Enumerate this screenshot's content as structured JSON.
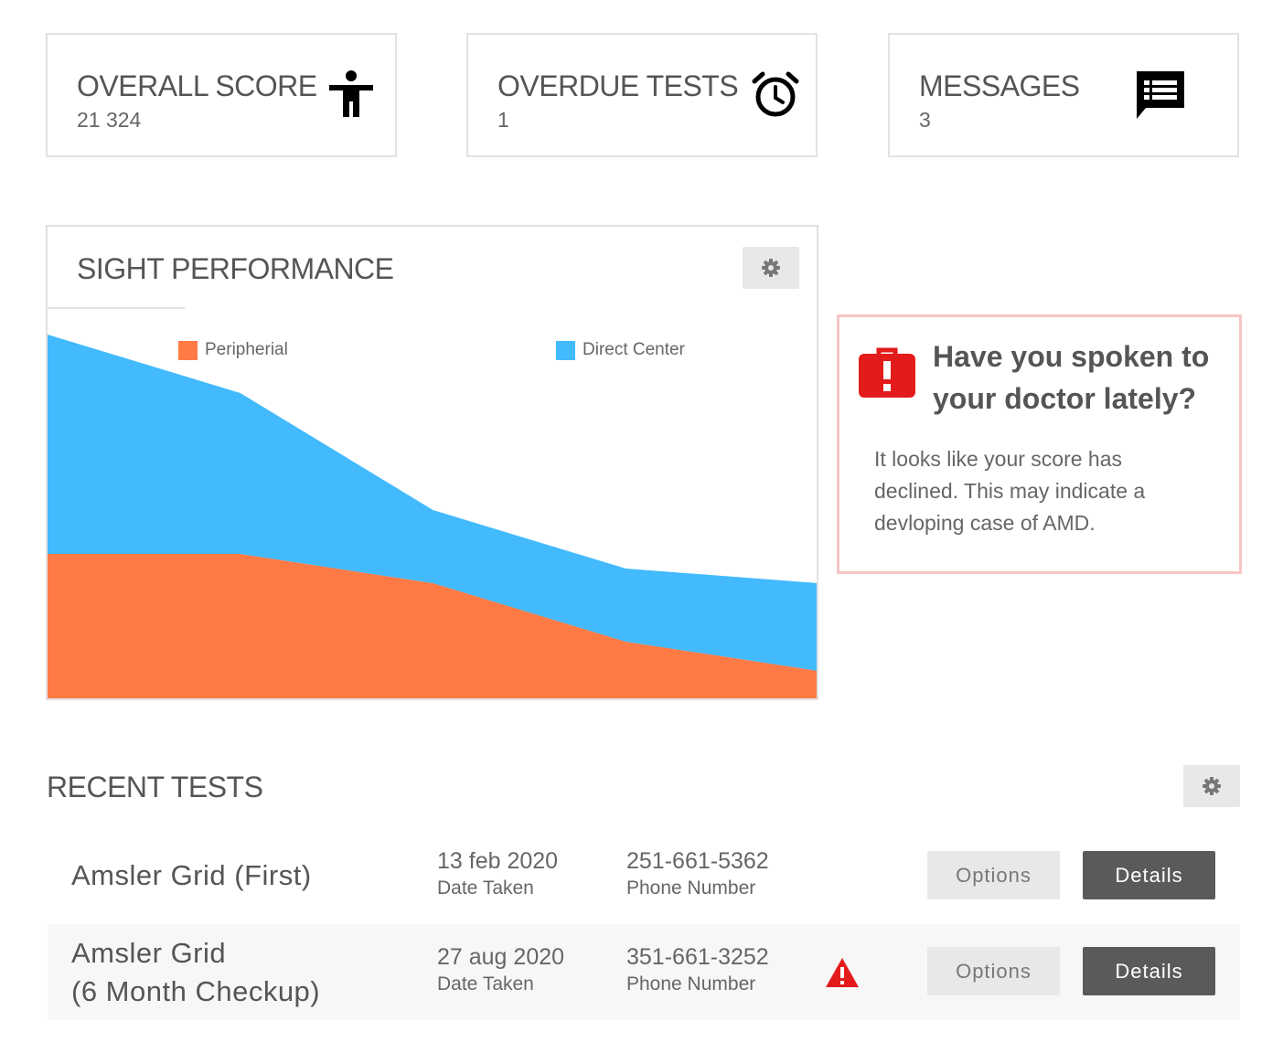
{
  "stats": {
    "score": {
      "title": "OVERALL SCORE",
      "value": "21 324",
      "icon": "accessibility-person-icon"
    },
    "overdue": {
      "title": "OVERDUE TESTS",
      "value": "1",
      "icon": "alarm-clock-icon"
    },
    "messages": {
      "title": "MESSAGES",
      "value": "3",
      "icon": "message-list-icon"
    }
  },
  "chart_panel": {
    "title": "SIGHT PERFORMANCE",
    "settings_icon": "gear-icon"
  },
  "chart_data": {
    "type": "area",
    "stacked": true,
    "grid": false,
    "legend": "top",
    "x": [
      1,
      2,
      3,
      4,
      5
    ],
    "series": [
      {
        "name": "Peripherial",
        "color": "#FF7A45",
        "values": [
          100,
          100,
          80,
          40,
          20
        ]
      },
      {
        "name": "Direct Center",
        "color": "#42BAFD",
        "values": [
          150,
          110,
          50,
          50,
          60
        ]
      }
    ],
    "ylim": [
      0,
      250
    ]
  },
  "alert": {
    "icon": "briefcase-alert-icon",
    "title": "Have you spoken to your doctor lately?",
    "body": "It looks like your score has declined. This may indicate a devloping case of AMD."
  },
  "recent_tests": {
    "title": "RECENT TESTS",
    "settings_icon": "gear-icon",
    "rows": [
      {
        "name": "Amsler Grid (First)",
        "date": "13 feb 2020",
        "date_label": "Date Taken",
        "phone": "251-661-5362",
        "phone_label": "Phone Number",
        "warning": false,
        "options_label": "Options",
        "details_label": "Details"
      },
      {
        "name_line1": "Amsler Grid",
        "name_line2": "(6 Month Checkup)",
        "date": "27 aug 2020",
        "date_label": "Date Taken",
        "phone": "351-661-3252",
        "phone_label": "Phone Number",
        "warning": true,
        "options_label": "Options",
        "details_label": "Details"
      }
    ]
  },
  "colors": {
    "alert_red": "#E31B1B",
    "alert_border": "#F7C6C4",
    "details_button": "#5A5A5A",
    "options_button": "#E8E8E8"
  }
}
